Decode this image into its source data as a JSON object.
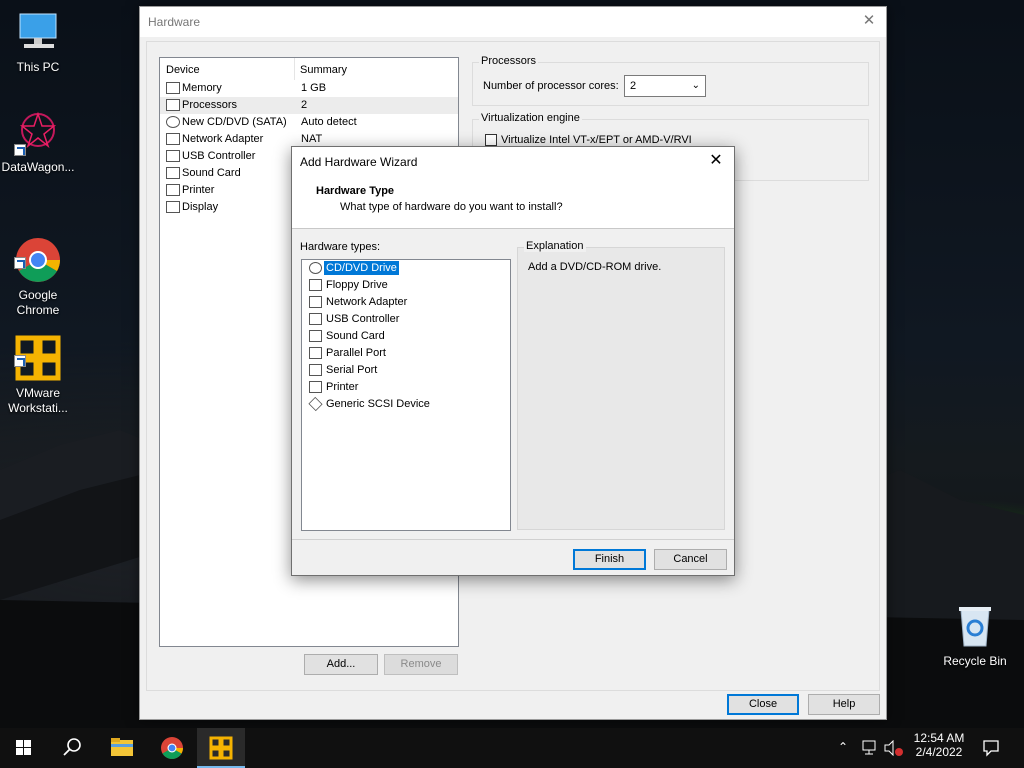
{
  "desktop": {
    "icons": [
      {
        "label": "This PC"
      },
      {
        "label": "DataWagon..."
      },
      {
        "label": "Google\nChrome"
      },
      {
        "label": "VMware\nWorkstati..."
      },
      {
        "label": "Recycle Bin"
      }
    ]
  },
  "hardware_window": {
    "title": "Hardware",
    "close_glyph": "✕",
    "device_list": {
      "col_device": "Device",
      "col_summary": "Summary",
      "rows": [
        {
          "name": "Memory",
          "summary": "1 GB",
          "icon": "memory-icon"
        },
        {
          "name": "Processors",
          "summary": "2",
          "icon": "processor-icon"
        },
        {
          "name": "New CD/DVD (SATA)",
          "summary": "Auto detect",
          "icon": "cd-dvd-icon"
        },
        {
          "name": "Network Adapter",
          "summary": "NAT",
          "icon": "network-adapter-icon"
        },
        {
          "name": "USB Controller",
          "summary": "",
          "icon": "usb-icon"
        },
        {
          "name": "Sound Card",
          "summary": "",
          "icon": "sound-icon"
        },
        {
          "name": "Printer",
          "summary": "",
          "icon": "printer-icon"
        },
        {
          "name": "Display",
          "summary": "",
          "icon": "display-icon"
        }
      ]
    },
    "add_button": "Add...",
    "remove_button": "Remove",
    "processors_group": {
      "label": "Processors",
      "cores_label": "Number of processor cores:",
      "cores_value": "2"
    },
    "virtualization_group": {
      "label": "Virtualization engine",
      "vtx_label": "Virtualize Intel VT-x/EPT or AMD-V/RVI"
    },
    "close_button": "Close",
    "help_button": "Help"
  },
  "wizard": {
    "title": "Add Hardware Wizard",
    "close_glyph": "✕",
    "heading": "Hardware Type",
    "subheading": "What type of hardware do you want to install?",
    "types_label": "Hardware types:",
    "types": [
      {
        "label": "CD/DVD Drive",
        "icon": "cd-dvd-icon"
      },
      {
        "label": "Floppy Drive",
        "icon": "floppy-icon"
      },
      {
        "label": "Network Adapter",
        "icon": "network-adapter-icon"
      },
      {
        "label": "USB Controller",
        "icon": "usb-icon"
      },
      {
        "label": "Sound Card",
        "icon": "sound-icon"
      },
      {
        "label": "Parallel Port",
        "icon": "parallel-port-icon"
      },
      {
        "label": "Serial Port",
        "icon": "serial-port-icon"
      },
      {
        "label": "Printer",
        "icon": "printer-icon"
      },
      {
        "label": "Generic SCSI Device",
        "icon": "scsi-icon"
      }
    ],
    "selected_type": "CD/DVD Drive",
    "explanation_label": "Explanation",
    "explanation_text": "Add a DVD/CD-ROM drive.",
    "finish_button": "Finish",
    "cancel_button": "Cancel"
  },
  "taskbar": {
    "time": "12:54 AM",
    "date": "2/4/2022"
  }
}
